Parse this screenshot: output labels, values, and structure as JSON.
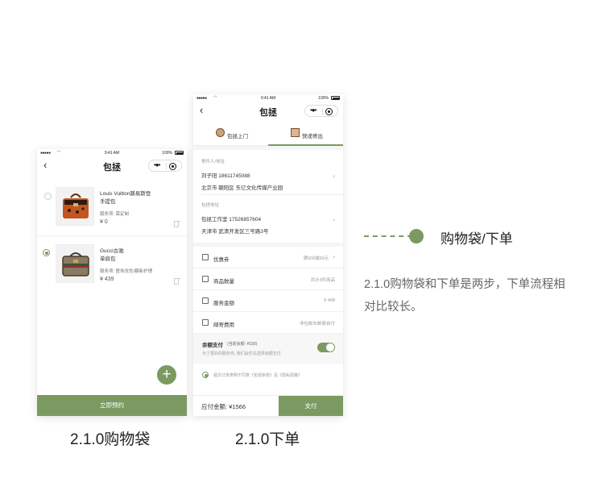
{
  "colors": {
    "accent": "#7b9a62"
  },
  "status_bar": {
    "carrier_dots": "●●●●●",
    "wifi_icon": "wifi-icon",
    "time": "9:41 AM",
    "battery": "100%"
  },
  "cart_screen": {
    "title": "包拯",
    "items": [
      {
        "brand": "Louis Vuitton路易斯登",
        "name": "手提包",
        "service": "服务项: 需定制",
        "price": "¥ 0",
        "selected": false
      },
      {
        "brand": "Gucci古驰",
        "name": "单肩包",
        "service": "服务项: 整体改色/翻新护理",
        "price": "¥ 439",
        "selected": true
      }
    ],
    "cta": "立即预约",
    "caption": "2.1.0购物袋"
  },
  "order_screen": {
    "title": "包拯",
    "tabs": [
      {
        "label": "包拯上门"
      },
      {
        "label": "快递寄出"
      }
    ],
    "sender": {
      "label": "寄件人/地址",
      "name_phone": "刘子阳 18611745088",
      "address": "北京市 朝阳区 东亿文化传媒产业园"
    },
    "shop": {
      "label": "包拯地址",
      "name_phone": "包拯工作室 17526857604",
      "address": "天津市 武清开发区三号路3号"
    },
    "rows": [
      {
        "label": "优惠券",
        "value": "满500减50元"
      },
      {
        "label": "商品数量",
        "value": "共计3件商品"
      },
      {
        "label": "服务金额",
        "value": "¥ 498"
      },
      {
        "label": "邮寄费用",
        "value": "非包邮右邮费自付"
      }
    ],
    "balance": {
      "title": "余额支付",
      "note": "(当前余额: ¥330)",
      "desc": "为了更好的服务你, 我们会优先选择余额支付"
    },
    "agreement": "提交订单表明于同意《包拯条款》及《隐私政策》",
    "total": "应付金额: ¥1566",
    "pay": "支付",
    "caption": "2.1.0下单"
  },
  "annotation": {
    "label": "购物袋/下单",
    "description": "2.1.0购物袋和下单是两步，下单流程相对比较长。"
  }
}
